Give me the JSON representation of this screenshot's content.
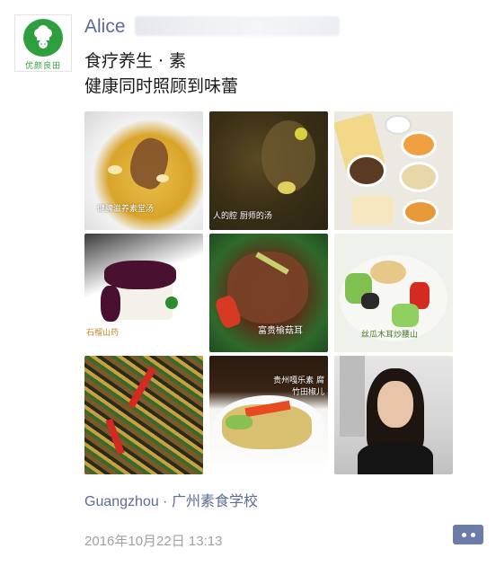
{
  "post": {
    "author": "Alice",
    "avatar_logo_text": "优颜良田",
    "text_lines": [
      "食疗养生 · 素",
      "健康同时照顾到味蕾"
    ],
    "location": "Guangzhou · 广州素食学校",
    "timestamp": "2016年10月22日 13:13"
  },
  "photos": [
    {
      "caption": "健脾滋养素堂汤"
    },
    {
      "caption": "人的腔 厨师的汤"
    },
    {
      "caption": ""
    },
    {
      "caption": "石榴山药"
    },
    {
      "caption": "富贵榆菇耳"
    },
    {
      "caption": "丝瓜木耳炒腰山"
    },
    {
      "caption": ""
    },
    {
      "caption": "贵州嘎乐素 腐竹田椒儿"
    },
    {
      "caption": ""
    }
  ],
  "icons": {
    "comment": "comment-dots-icon",
    "avatar": "chef-hat-logo"
  },
  "colors": {
    "link_blue": "#5b6b94",
    "timestamp_gray": "#a0a0a0",
    "logo_green": "#2f9e3f"
  }
}
